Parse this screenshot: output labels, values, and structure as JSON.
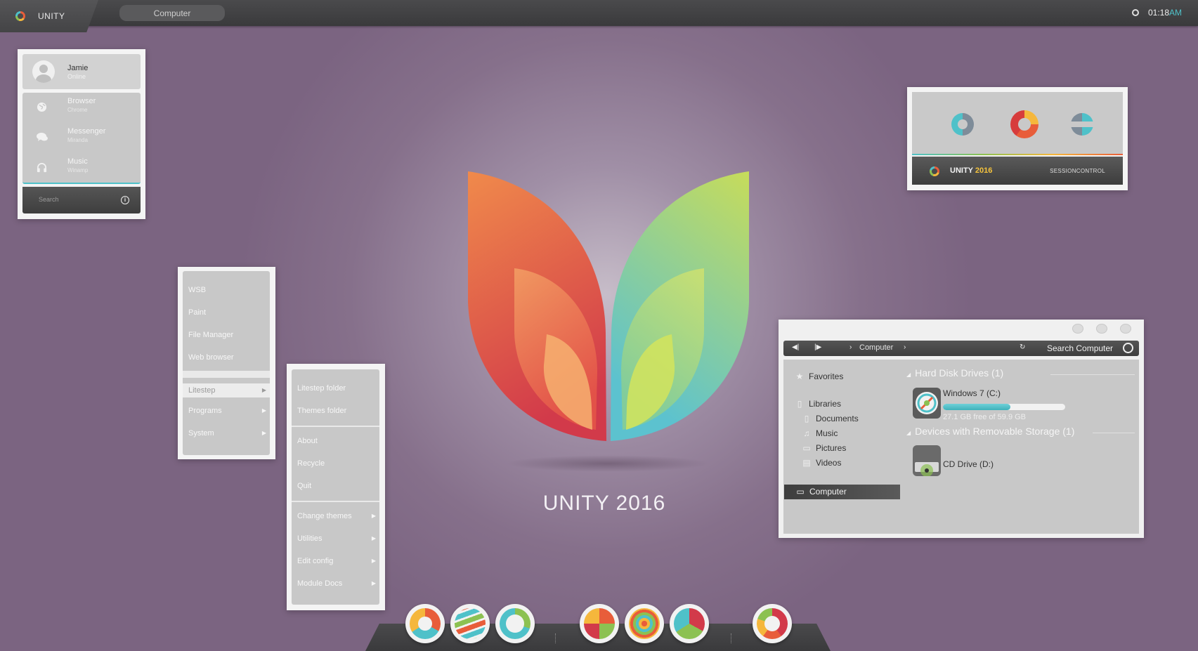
{
  "topbar": {
    "title": "UNITY",
    "tab_label": "Computer",
    "clock": "01:18",
    "clock_ampm": "AM"
  },
  "user_panel": {
    "name": "Jamie",
    "status": "Online",
    "items": [
      {
        "label": "Browser",
        "sub": "Chrome",
        "icon": "globe-icon"
      },
      {
        "label": "Messenger",
        "sub": "Miranda",
        "icon": "chat-icon"
      },
      {
        "label": "Music",
        "sub": "Winamp",
        "icon": "headphones-icon"
      }
    ],
    "search_placeholder": "Search"
  },
  "session_widget": {
    "title": "UNITY",
    "year": "2016",
    "control_label": "SESSIONCONTROL"
  },
  "start_menu": {
    "top_items": [
      "WSB",
      "Paint",
      "File Manager",
      "Web browser"
    ],
    "selected_item": "Litestep",
    "bottom_items": [
      {
        "label": "Programs",
        "has_submenu": true
      },
      {
        "label": "System",
        "has_submenu": true
      }
    ]
  },
  "litestep_menu": {
    "group1": [
      "Litestep folder",
      "Themes folder"
    ],
    "group2": [
      "About",
      "Recycle",
      "Quit"
    ],
    "group3": [
      "Change themes",
      "Utilities",
      "Edit config",
      "Module Docs"
    ]
  },
  "wallpaper": {
    "caption": "UNITY 2016"
  },
  "explorer": {
    "breadcrumb": "Computer",
    "search_label": "Search Computer",
    "nav": {
      "favorites": "Favorites",
      "libraries": "Libraries",
      "library_items": [
        {
          "label": "Documents",
          "icon": "document-icon"
        },
        {
          "label": "Music",
          "icon": "music-note-icon"
        },
        {
          "label": "Pictures",
          "icon": "picture-icon"
        },
        {
          "label": "Videos",
          "icon": "film-icon"
        }
      ],
      "computer": "Computer"
    },
    "groups": {
      "hard_disks": "Hard Disk Drives (1)",
      "removable": "Devices with Removable Storage (1)"
    },
    "drives": {
      "c_name": "Windows 7 (C:)",
      "c_free": "27.1 GB free of 59.9 GB",
      "c_used_fraction": 0.55,
      "d_name": "CD Drive (D:)"
    }
  },
  "colors": {
    "accent_teal": "#4fc1c9",
    "accent_orange": "#e85d3a",
    "accent_green": "#8cc152",
    "accent_yellow": "#f5b73c",
    "desktop_purple": "#86708b"
  },
  "dock": {
    "icons": [
      "chrome-like-icon",
      "waves-icon",
      "ring-icon",
      "tiles-icon",
      "spiral-icon",
      "triad-icon",
      "unity-icon"
    ]
  }
}
